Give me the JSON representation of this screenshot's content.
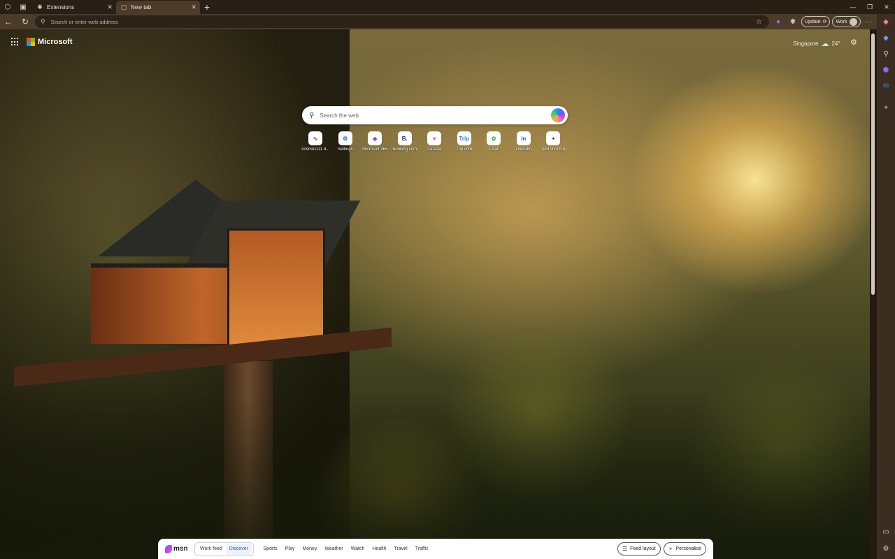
{
  "tabs": [
    {
      "label": "Extensions",
      "favicon": "puzzle-icon"
    },
    {
      "label": "New tab",
      "favicon": "page-icon"
    }
  ],
  "address_bar": {
    "placeholder": "Search or enter web address"
  },
  "toolbar": {
    "update_label": "Update",
    "profile_label": "Work"
  },
  "ntp": {
    "brand": "Microsoft",
    "weather": {
      "location": "Singapore",
      "temp": "24°"
    },
    "search_placeholder": "Search the web",
    "shortcuts": [
      {
        "label": "cosmo1111 d...",
        "glyph": "∿",
        "color": "#555555"
      },
      {
        "label": "Settings",
        "glyph": "⚙",
        "color": "#1a6fd8"
      },
      {
        "label": "Microsoft 365",
        "glyph": "◆",
        "color": "#7a4dff"
      },
      {
        "label": "Booking.com",
        "glyph": "B.",
        "color": "#003580"
      },
      {
        "label": "Lazada",
        "glyph": "♥",
        "color": "#f04e6a"
      },
      {
        "label": "Trip.com",
        "glyph": "Trip",
        "color": "#2f7df6"
      },
      {
        "label": "Chat",
        "glyph": "✿",
        "color": "#3bb34a"
      },
      {
        "label": "LinkedIn",
        "glyph": "in",
        "color": "#0a66c2"
      },
      {
        "label": "Add shortcut",
        "glyph": "+",
        "color": "#333333"
      }
    ]
  },
  "msn": {
    "logo": "msn",
    "feed_options": [
      "Work feed",
      "Discover"
    ],
    "categories": [
      "Sports",
      "Play",
      "Money",
      "Weather",
      "Watch",
      "Health",
      "Travel",
      "Traffic"
    ],
    "feed_layout_label": "Feed layout",
    "personalise_label": "Personalise"
  }
}
